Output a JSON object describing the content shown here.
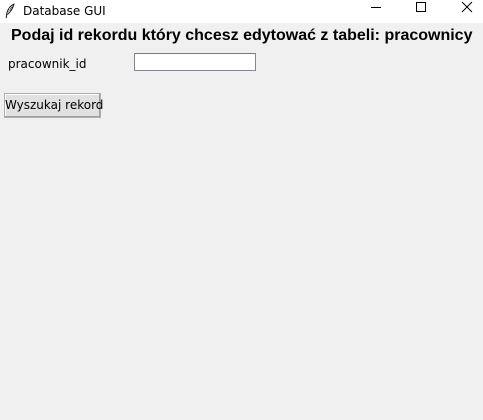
{
  "window": {
    "title": "Database GUI",
    "icon": "feather-icon",
    "controls": {
      "minimize_icon": "minimize-icon",
      "maximize_icon": "maximize-icon",
      "close_icon": "close-icon"
    }
  },
  "form": {
    "heading": "Podaj id rekordu który chcesz edytować z tabeli: pracownicy",
    "field_label": "pracownik_id",
    "field_value": "",
    "submit_label": "Wyszukaj rekord"
  },
  "colors": {
    "background": "#f0f0f0",
    "titlebar": "#ffffff",
    "button_face": "#e1e1e1",
    "button_border": "#adadad"
  }
}
